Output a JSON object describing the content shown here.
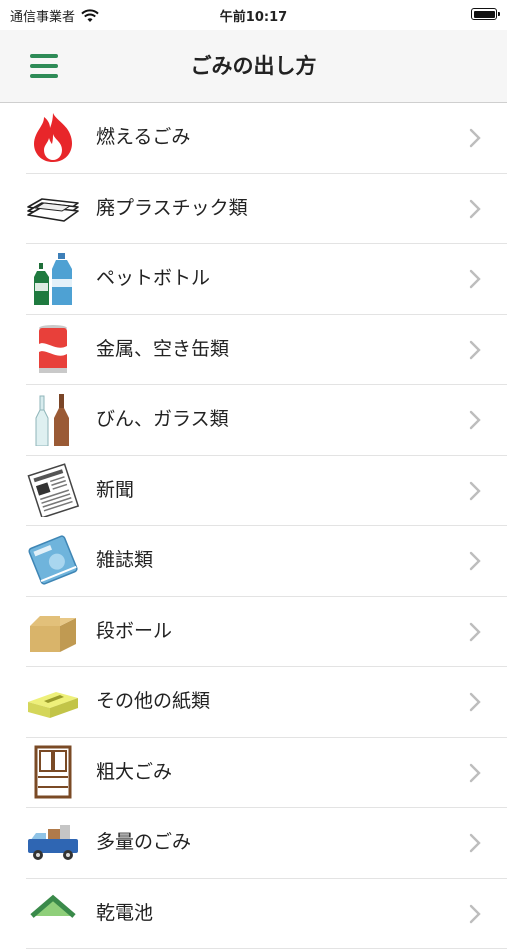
{
  "status_bar": {
    "carrier": "通信事業者",
    "time": "午前10:17"
  },
  "nav": {
    "title": "ごみの出し方",
    "menu_icon": "hamburger-menu-icon"
  },
  "accent_color": "#2e8b57",
  "categories": [
    {
      "label": "燃えるごみ",
      "icon": "flame-icon"
    },
    {
      "label": "廃プラスチック類",
      "icon": "plastic-tray-icon"
    },
    {
      "label": "ペットボトル",
      "icon": "pet-bottle-icon"
    },
    {
      "label": "金属、空き缶類",
      "icon": "can-icon"
    },
    {
      "label": "びん、ガラス類",
      "icon": "glass-bottle-icon"
    },
    {
      "label": "新聞",
      "icon": "newspaper-icon"
    },
    {
      "label": "雑誌類",
      "icon": "magazine-icon"
    },
    {
      "label": "段ボール",
      "icon": "cardboard-box-icon"
    },
    {
      "label": "その他の紙類",
      "icon": "tissue-box-icon"
    },
    {
      "label": "粗大ごみ",
      "icon": "cabinet-icon"
    },
    {
      "label": "多量のごみ",
      "icon": "truck-icon"
    },
    {
      "label": "乾電池",
      "icon": "house-icon"
    }
  ]
}
